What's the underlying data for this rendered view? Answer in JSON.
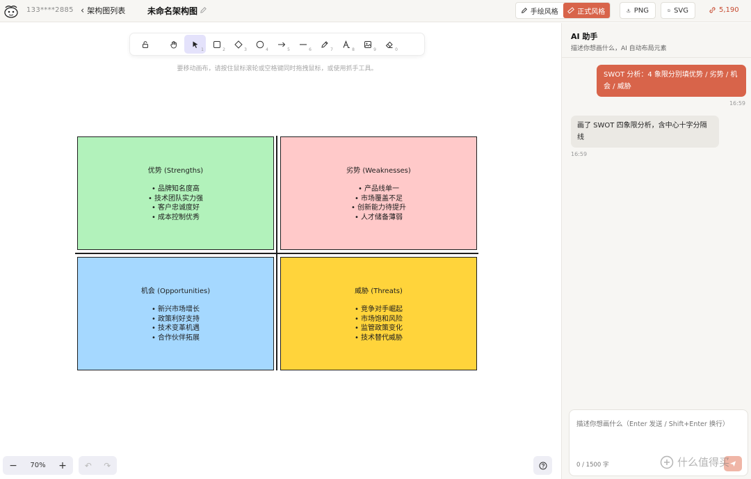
{
  "header": {
    "user_id": "133****2885",
    "back_label": "架构图列表",
    "doc_title": "未命名架构图",
    "style_hand": "手绘风格",
    "style_formal": "正式风格",
    "export_png": "PNG",
    "export_svg": "SVG",
    "credits": "5,190",
    "accent_color": "#d8644a"
  },
  "toolbar": {
    "tools": [
      {
        "icon": "lock-icon",
        "num": ""
      },
      {
        "icon": "hand-icon",
        "num": ""
      },
      {
        "icon": "pointer-icon",
        "num": "1"
      },
      {
        "icon": "rectangle-icon",
        "num": "2"
      },
      {
        "icon": "diamond-icon",
        "num": "3"
      },
      {
        "icon": "ellipse-icon",
        "num": "4"
      },
      {
        "icon": "arrow-icon",
        "num": "5"
      },
      {
        "icon": "line-icon",
        "num": "6"
      },
      {
        "icon": "pencil-icon",
        "num": "7"
      },
      {
        "icon": "text-icon",
        "num": "8"
      },
      {
        "icon": "image-icon",
        "num": "9"
      },
      {
        "icon": "eraser-icon",
        "num": "0"
      }
    ],
    "hint": "要移动画布，请按住鼠标滚轮或空格键同时拖拽鼠标，或使用抓手工具。"
  },
  "diagram": {
    "strengths": {
      "title": "优势 (Strengths)",
      "items": [
        "• 品牌知名度高",
        "• 技术团队实力强",
        "• 客户忠诚度好",
        "• 成本控制优秀"
      ],
      "color": "#b2f2bb"
    },
    "weaknesses": {
      "title": "劣势 (Weaknesses)",
      "items": [
        "• 产品线单一",
        "• 市场覆盖不足",
        "• 创新能力待提升",
        "• 人才储备薄弱"
      ],
      "color": "#ffc9c9"
    },
    "opportunities": {
      "title": "机会 (Opportunities)",
      "items": [
        "• 新兴市场增长",
        "• 政策利好支持",
        "• 技术变革机遇",
        "• 合作伙伴拓展"
      ],
      "color": "#a5d8ff"
    },
    "threats": {
      "title": "威胁 (Threats)",
      "items": [
        "• 竞争对手崛起",
        "• 市场饱和风险",
        "• 监管政策变化",
        "• 技术替代威胁"
      ],
      "color": "#ffd43b"
    }
  },
  "canvas_controls": {
    "zoom_minus": "−",
    "zoom_level": "70%",
    "zoom_plus": "+",
    "undo": "↶",
    "redo": "↷"
  },
  "ai_panel": {
    "title": "AI 助手",
    "subtitle": "描述你想画什么，AI 自动布局元素",
    "messages": [
      {
        "role": "user",
        "text": "SWOT 分析：4 象限分别填优势 / 劣势 / 机会 / 威胁",
        "time": "16:59"
      },
      {
        "role": "ai",
        "text": "画了 SWOT 四象限分析，含中心十字分隔线",
        "time": "16:59"
      }
    ],
    "input_placeholder": "描述你想画什么（Enter 发送 / Shift+Enter 换行）",
    "char_count": "0 / 1500 字"
  },
  "watermark": "什么值得买"
}
